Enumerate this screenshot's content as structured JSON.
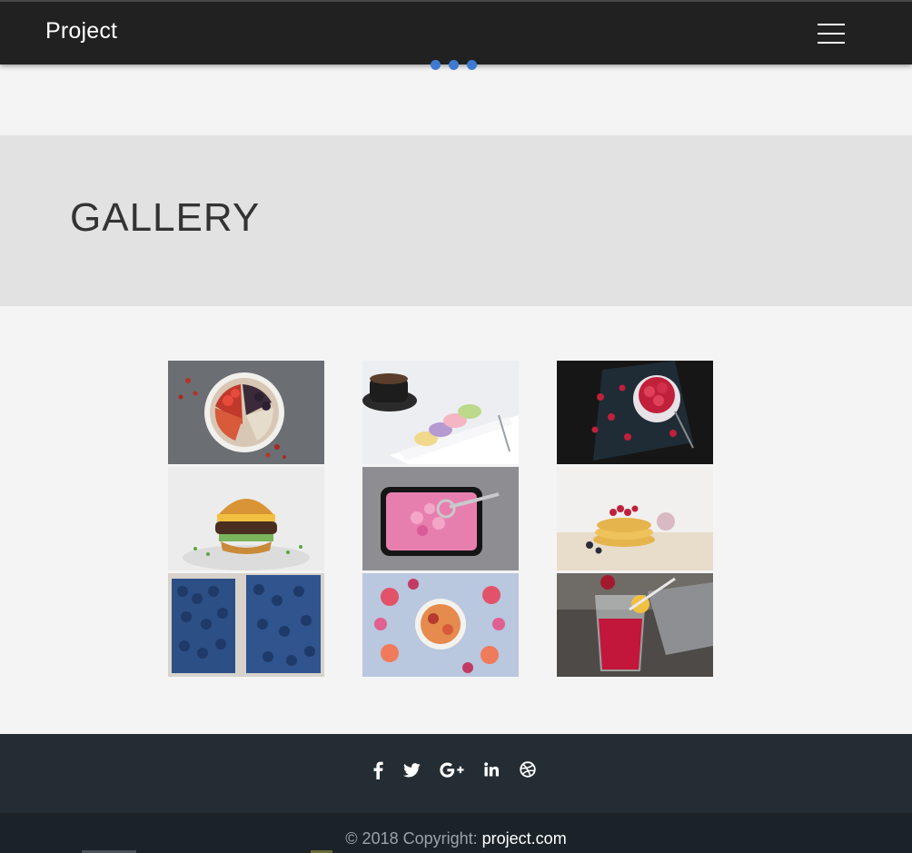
{
  "navbar": {
    "brand": "Project",
    "menu_icon": "hamburger-menu-icon"
  },
  "loader": {
    "icon": "loading-dots-icon",
    "color": "#3e7bd0"
  },
  "header": {
    "title": "GALLERY"
  },
  "gallery": {
    "images": [
      {
        "name": "smoothie-bowl-image"
      },
      {
        "name": "coffee-macarons-image"
      },
      {
        "name": "raspberries-bowl-image"
      },
      {
        "name": "burger-image"
      },
      {
        "name": "pink-ice-cream-image"
      },
      {
        "name": "pancakes-image"
      },
      {
        "name": "blueberries-image"
      },
      {
        "name": "fruit-bowl-image"
      },
      {
        "name": "red-drink-image"
      }
    ]
  },
  "footer": {
    "social": [
      {
        "icon": "facebook-icon"
      },
      {
        "icon": "twitter-icon"
      },
      {
        "icon": "google-plus-icon"
      },
      {
        "icon": "linkedin-icon"
      },
      {
        "icon": "dribbble-icon"
      }
    ],
    "copyright_prefix": "© 2018 Copyright: ",
    "copyright_link": "project.com"
  },
  "colors": {
    "navbar": "#212121",
    "page_background": "#f4f4f4",
    "header_band": "#e2e2e2",
    "footer_social": "#232d33",
    "footer_copyright": "#1b2328"
  }
}
